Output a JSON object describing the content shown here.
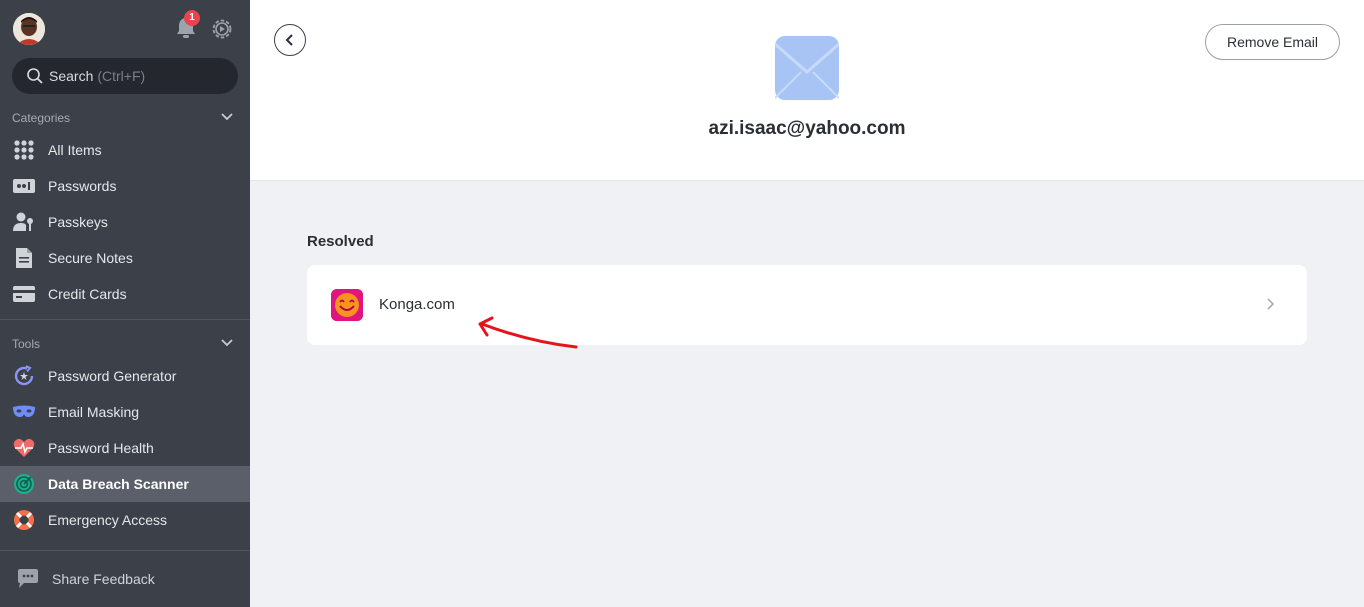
{
  "sidebar": {
    "notification_count": "1",
    "search": {
      "label": "Search",
      "shortcut": "(Ctrl+F)"
    },
    "categories_heading": "Categories",
    "categories": [
      {
        "label": "All Items",
        "icon": "grid-icon"
      },
      {
        "label": "Passwords",
        "icon": "password-icon"
      },
      {
        "label": "Passkeys",
        "icon": "passkey-icon"
      },
      {
        "label": "Secure Notes",
        "icon": "note-icon"
      },
      {
        "label": "Credit Cards",
        "icon": "credit-card-icon"
      }
    ],
    "tools_heading": "Tools",
    "tools": [
      {
        "label": "Password Generator",
        "icon": "generator-icon"
      },
      {
        "label": "Email Masking",
        "icon": "mask-icon"
      },
      {
        "label": "Password Health",
        "icon": "heart-pulse-icon"
      },
      {
        "label": "Data Breach Scanner",
        "icon": "radar-icon",
        "active": true
      },
      {
        "label": "Emergency Access",
        "icon": "lifebuoy-icon"
      }
    ],
    "feedback_label": "Share Feedback"
  },
  "header": {
    "email": "azi.isaac@yahoo.com",
    "remove_label": "Remove Email"
  },
  "main": {
    "section_label": "Resolved",
    "items": [
      {
        "name": "Konga.com",
        "icon": "konga-logo-icon"
      }
    ]
  },
  "colors": {
    "sidebar_bg": "#3b4049",
    "active_item_bg": "#5a5f69",
    "main_bg": "#f0f1f4",
    "envelope": "#a8c4f5",
    "badge": "#e8434f",
    "annotation_arrow": "#e5141c"
  }
}
